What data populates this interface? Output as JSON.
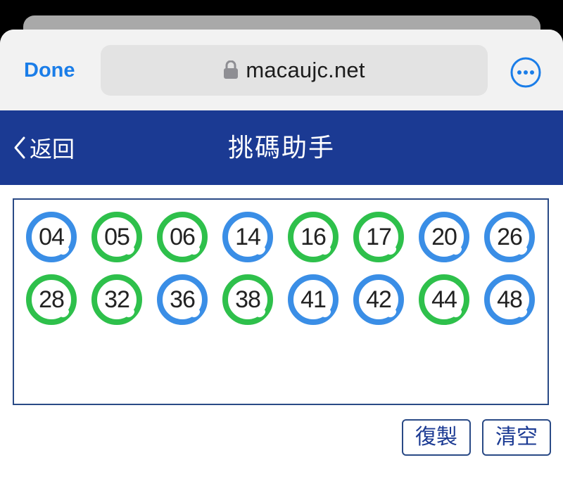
{
  "browser": {
    "done_label": "Done",
    "url": "macaujc.net",
    "lock_icon": "lock-icon",
    "more_icon": "ellipsis-circle-icon",
    "accent": "#1a7de8"
  },
  "header": {
    "back_label": "返回",
    "title": "挑碼助手",
    "background": "#1b3a93"
  },
  "selected_numbers": [
    {
      "number": "04",
      "color": "blue"
    },
    {
      "number": "05",
      "color": "green"
    },
    {
      "number": "06",
      "color": "green"
    },
    {
      "number": "14",
      "color": "blue"
    },
    {
      "number": "16",
      "color": "green"
    },
    {
      "number": "17",
      "color": "green"
    },
    {
      "number": "20",
      "color": "blue"
    },
    {
      "number": "26",
      "color": "blue"
    },
    {
      "number": "28",
      "color": "green"
    },
    {
      "number": "32",
      "color": "green"
    },
    {
      "number": "36",
      "color": "blue"
    },
    {
      "number": "38",
      "color": "green"
    },
    {
      "number": "41",
      "color": "blue"
    },
    {
      "number": "42",
      "color": "blue"
    },
    {
      "number": "44",
      "color": "green"
    },
    {
      "number": "48",
      "color": "blue"
    }
  ],
  "colors": {
    "blue": "#3a8ee6",
    "green": "#2ec04b"
  },
  "actions": {
    "copy_label": "復製",
    "clear_label": "清空"
  }
}
